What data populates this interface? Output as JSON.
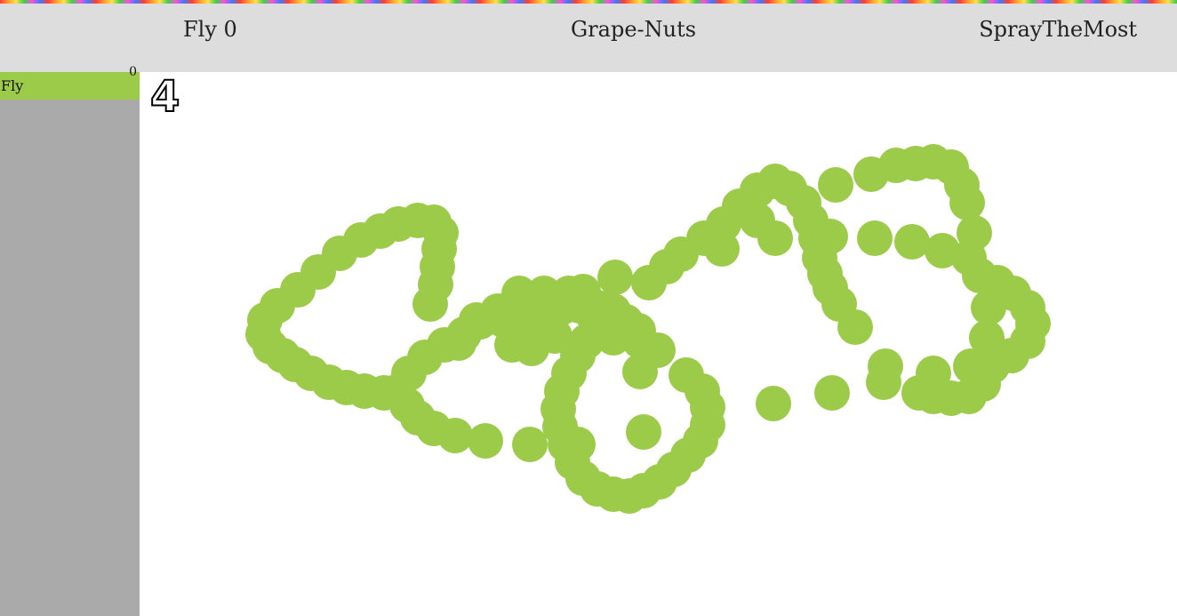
{
  "header": {
    "left": "Fly 0",
    "center": "Grape-Nuts",
    "right": "SprayTheMost"
  },
  "players": [
    {
      "name": "Fly",
      "score": "0",
      "color": "#9ccb4a"
    }
  ],
  "timer": "4",
  "drawing": {
    "color": "#9ccb4a"
  }
}
